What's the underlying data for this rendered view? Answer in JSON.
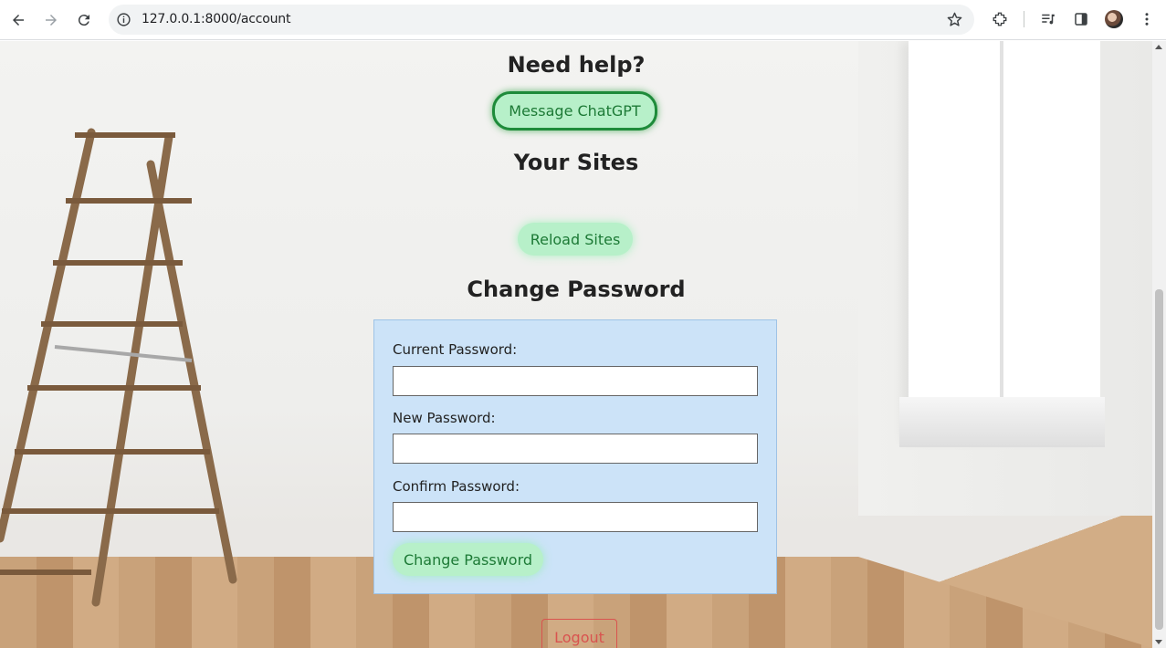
{
  "browser": {
    "url": "127.0.0.1:8000/account",
    "icons": [
      "back-icon",
      "forward-icon",
      "reload-icon",
      "site-info-icon",
      "bookmark-star-icon",
      "extensions-icon",
      "media-control-icon",
      "side-panel-icon",
      "profile-avatar",
      "more-menu-icon"
    ]
  },
  "page": {
    "help_heading": "Need help?",
    "chatgpt_button": "Message ChatGPT",
    "sites_heading": "Your Sites",
    "reload_button": "Reload Sites",
    "password_heading": "Change Password",
    "form": {
      "current_label": "Current Password:",
      "current_value": "",
      "new_label": "New Password:",
      "new_value": "",
      "confirm_label": "Confirm Password:",
      "confirm_value": "",
      "submit_label": "Change Password"
    },
    "logout_button": "Logout"
  },
  "colors": {
    "pill_bg": "#b7f0c9",
    "pill_text": "#1d7a36",
    "panel_bg": "#cce3f8",
    "logout": "#d9534f"
  }
}
